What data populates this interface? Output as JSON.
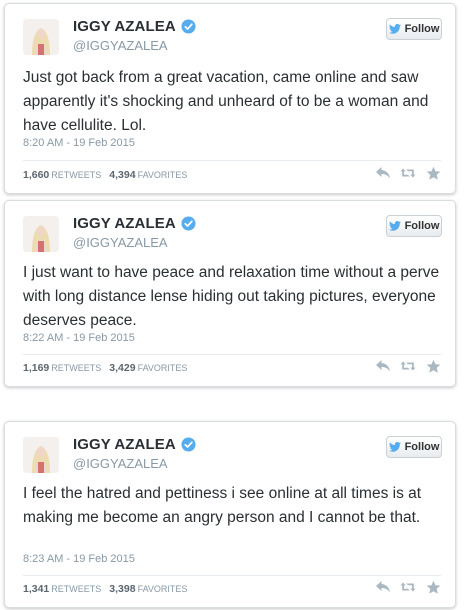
{
  "colors": {
    "text": "#292f33",
    "muted": "#8899a6",
    "verified": "#55acee",
    "bird": "#55acee"
  },
  "icons": {
    "verified": "verified-badge-icon",
    "follow": "twitter-bird-icon",
    "reply": "reply-icon",
    "retweet": "retweet-icon",
    "favorite": "star-icon"
  },
  "tweets": [
    {
      "name": "IGGY AZALEA",
      "handle": "@IGGYAZALEA",
      "follow_label": "Follow",
      "text": "Just got back from a great vacation, came online and saw apparently it's shocking and unheard of to be a woman and have cellulite. Lol.",
      "timestamp": "8:20 AM - 19 Feb 2015",
      "retweets": "1,660",
      "retweets_label": "RETWEETS",
      "favorites": "4,394",
      "favorites_label": "FAVORITES"
    },
    {
      "name": "IGGY AZALEA",
      "handle": "@IGGYAZALEA",
      "follow_label": "Follow",
      "text": "I just want to have peace and relaxation time without a perve with long distance lense hiding out taking pictures, everyone deserves peace.",
      "timestamp": "8:22 AM - 19 Feb 2015",
      "retweets": "1,169",
      "retweets_label": "RETWEETS",
      "favorites": "3,429",
      "favorites_label": "FAVORITES"
    },
    {
      "name": "IGGY AZALEA",
      "handle": "@IGGYAZALEA",
      "follow_label": "Follow",
      "text": "I feel the hatred and pettiness i see online at all times is at making me become an angry person and I cannot be that.",
      "timestamp": "8:23 AM - 19 Feb 2015",
      "retweets": "1,341",
      "retweets_label": "RETWEETS",
      "favorites": "3,398",
      "favorites_label": "FAVORITES"
    }
  ]
}
